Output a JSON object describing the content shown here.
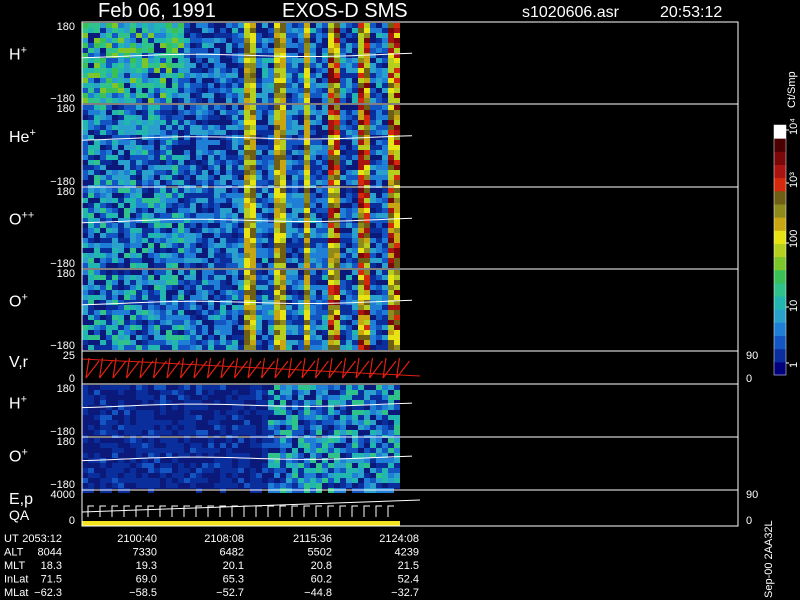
{
  "header": {
    "date": "Feb 06, 1991",
    "instrument": "EXOS-D SMS",
    "file": "s1020606.asr",
    "time": "20:53:12"
  },
  "colorbar": {
    "title": "Ct/Smp",
    "labels": [
      "1",
      "10",
      "100",
      "10³",
      "10⁴"
    ],
    "colors": [
      "#00007a",
      "#0a2e9c",
      "#1455c4",
      "#1f7fd6",
      "#2aa0cc",
      "#22b6b0",
      "#2fc28a",
      "#39c158",
      "#7cc52b",
      "#b6cf1f",
      "#e8e414",
      "#c8a612",
      "#8f8a1c",
      "#6f5f15",
      "#d42a0b",
      "#aa1410",
      "#7a0808",
      "#4a0000",
      "#ffffff"
    ]
  },
  "panels": [
    {
      "name": "H+",
      "label": "H",
      "sup": "+",
      "ytop": "180",
      "ybot": "−180"
    },
    {
      "name": "He+",
      "label": "He",
      "sup": "+",
      "ytop": "180",
      "ybot": "−180"
    },
    {
      "name": "O++",
      "label": "O",
      "sup": "++",
      "ytop": "180",
      "ybot": "−180"
    },
    {
      "name": "O+",
      "label": "O",
      "sup": "+",
      "ytop": "180",
      "ybot": "−180"
    },
    {
      "name": "V,r",
      "label": "V,r",
      "sup": "",
      "ytop": "25",
      "ybot": "0",
      "rtop": "90",
      "rbot": "0"
    },
    {
      "name": "H+ (2)",
      "label": "H",
      "sup": "+",
      "ytop": "180",
      "ybot": "−180"
    },
    {
      "name": "O+ (2)",
      "label": "O",
      "sup": "+",
      "ytop": "180",
      "ybot": "−180"
    },
    {
      "name": "E,p QA",
      "label": "E,p",
      "label2": "QA",
      "sup": "",
      "ytop": "4000",
      "ybot": "0",
      "rtop": "90",
      "rbot": "0"
    }
  ],
  "table": {
    "rows": [
      {
        "label": "UT",
        "values": [
          "2053:12",
          "2100:40",
          "2108:08",
          "2115:36",
          "2124:08"
        ]
      },
      {
        "label": "ALT",
        "values": [
          "8044",
          "7330",
          "6482",
          "5502",
          "4239"
        ]
      },
      {
        "label": "MLT",
        "values": [
          "18.3",
          "19.3",
          "20.1",
          "20.8",
          "21.5"
        ]
      },
      {
        "label": "InLat",
        "values": [
          "71.5",
          "69.0",
          "65.3",
          "60.2",
          "52.4"
        ]
      },
      {
        "label": "MLat",
        "values": [
          "−62.3",
          "−58.5",
          "−52.7",
          "−44.8",
          "−32.7"
        ]
      }
    ]
  },
  "footer_note": "Sep-00  2AA32L",
  "chart_data": {
    "type": "heatmap",
    "title": "Feb 06, 1991   EXOS-D SMS",
    "x_tick_labels": [
      "2053:12",
      "2100:40",
      "2108:08",
      "2115:36",
      "2124:08"
    ],
    "series": [
      {
        "name": "H+",
        "ylim": [
          -180,
          180
        ],
        "data_extent_fraction": 0.95
      },
      {
        "name": "He+",
        "ylim": [
          -180,
          180
        ],
        "data_extent_fraction": 0.95
      },
      {
        "name": "O++",
        "ylim": [
          -180,
          180
        ],
        "data_extent_fraction": 0.95
      },
      {
        "name": "O+",
        "ylim": [
          -180,
          180
        ],
        "data_extent_fraction": 0.95
      },
      {
        "name": "V,r",
        "ylim": [
          0,
          25
        ],
        "ylim_right": [
          0,
          90
        ]
      },
      {
        "name": "H+",
        "ylim": [
          -180,
          180
        ],
        "data_extent_fraction": 0.95
      },
      {
        "name": "O+",
        "ylim": [
          -180,
          180
        ],
        "data_extent_fraction": 0.95
      },
      {
        "name": "E,p QA",
        "ylim": [
          0,
          4000
        ],
        "ylim_right": [
          0,
          90
        ]
      }
    ],
    "colorbar_scale": "log",
    "colorbar_range": [
      1,
      10000
    ],
    "colorbar_unit": "Ct/Smp"
  }
}
